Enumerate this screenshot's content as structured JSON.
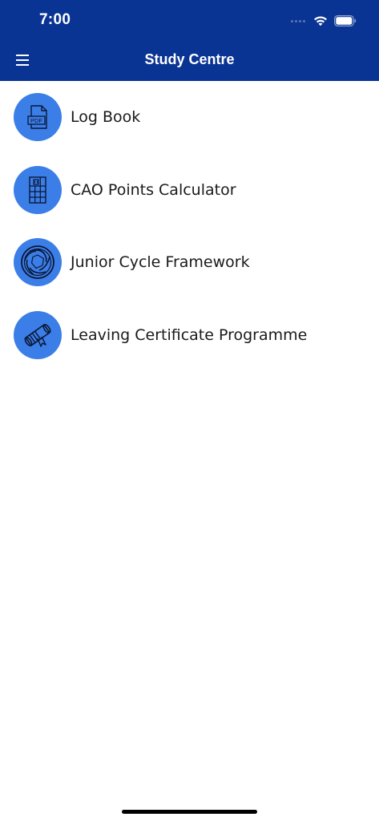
{
  "status_bar": {
    "time": "7:00"
  },
  "nav": {
    "title": "Study Centre",
    "menu_icon": "hamburger-menu-icon"
  },
  "items": [
    {
      "label": "Log Book",
      "icon": "pdf-document-icon",
      "icon_text": "PDF"
    },
    {
      "label": "CAO Points Calculator",
      "icon": "calculator-grid-icon"
    },
    {
      "label": "Junior Cycle Framework",
      "icon": "aperture-icon"
    },
    {
      "label": "Leaving Certificate Programme",
      "icon": "diploma-scroll-icon"
    }
  ],
  "colors": {
    "header": "#0a3493",
    "icon_circle": "#3b7ee8",
    "text": "#1a1a1a",
    "background": "#ffffff"
  }
}
